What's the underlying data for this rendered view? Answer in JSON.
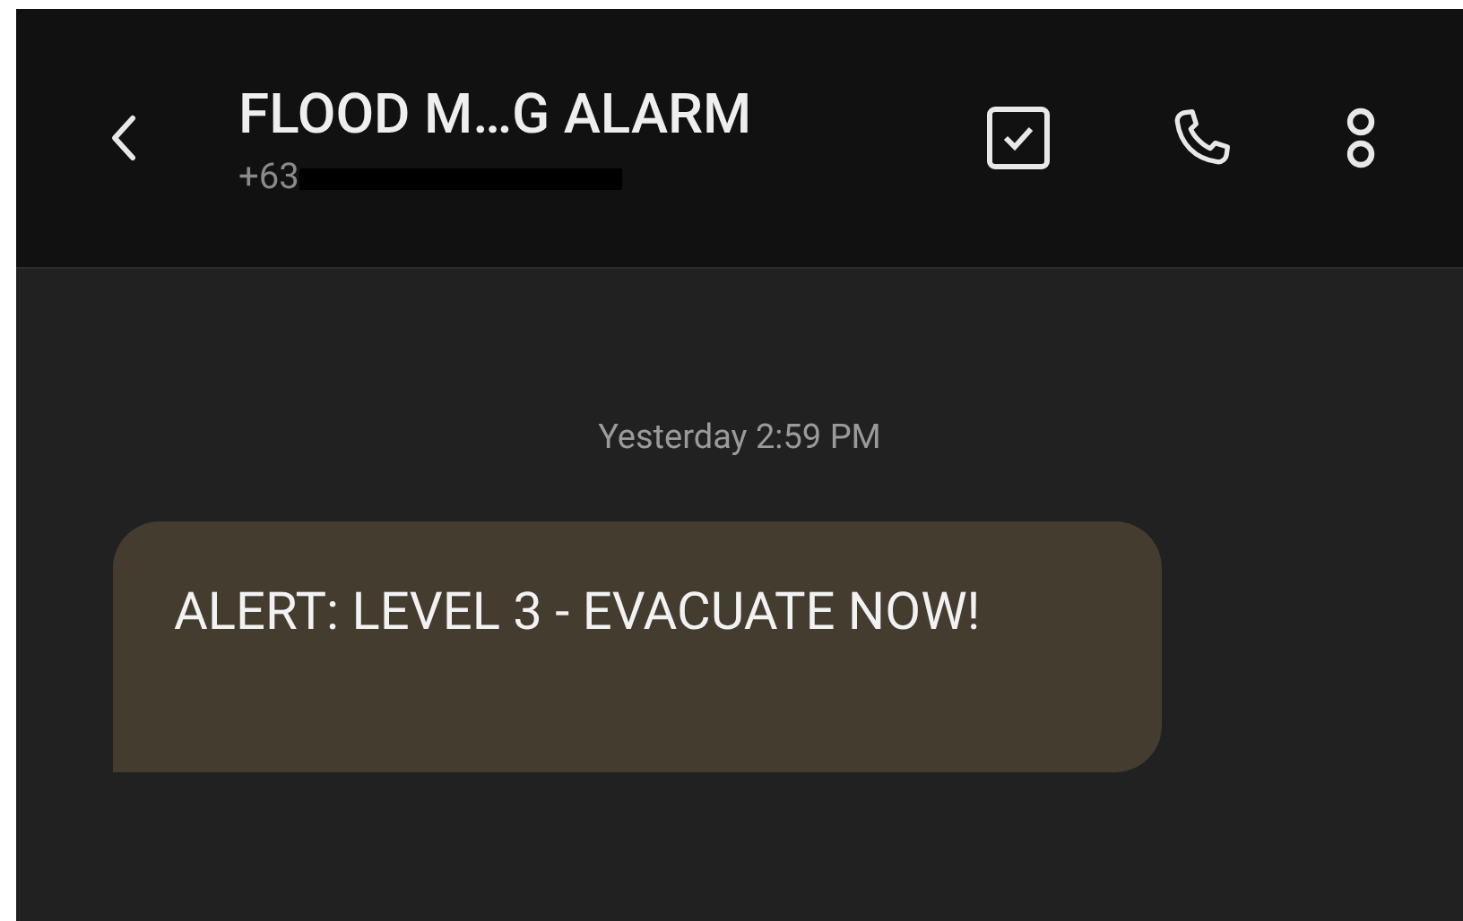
{
  "header": {
    "title": "FLOOD M…G ALARM",
    "subtitle": "+63",
    "subtitle_redacted": true
  },
  "messages": [
    {
      "kind": "timestamp",
      "text": "Yesterday 2:59 PM"
    },
    {
      "kind": "incoming",
      "text": "ALERT: LEVEL 3 - EVACUATE NOW!"
    }
  ]
}
